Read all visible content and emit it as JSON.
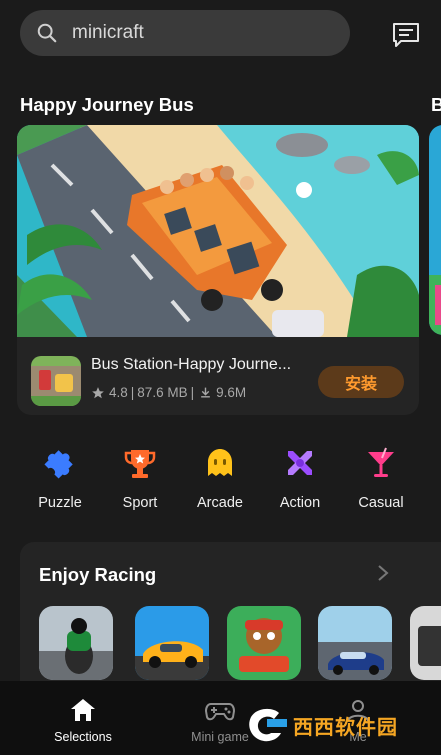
{
  "search": {
    "query": "minicraft"
  },
  "header": {
    "message_icon": "message-icon"
  },
  "featured": {
    "section_title": "Happy Journey Bus",
    "next_section_title": "B",
    "app": {
      "name": "Bus Station-Happy Journe...",
      "rating": "4.8",
      "size": "87.6 MB",
      "downloads": "9.6M",
      "install_label": "安装"
    }
  },
  "categories": [
    {
      "label": "Puzzle",
      "icon": "puzzle-icon",
      "color": "#3b7cff"
    },
    {
      "label": "Sport",
      "icon": "trophy-icon",
      "color": "#ff6a2b"
    },
    {
      "label": "Arcade",
      "icon": "arcade-ghost-icon",
      "color": "#ffc21a"
    },
    {
      "label": "Action",
      "icon": "crossed-swords-icon",
      "color": "#9b4dff"
    },
    {
      "label": "Casual",
      "icon": "cocktail-icon",
      "color": "#ff3d8b"
    }
  ],
  "racing": {
    "title": "Enjoy Racing"
  },
  "bottom_nav": [
    {
      "label": "Selections",
      "icon": "home-icon",
      "active": true
    },
    {
      "label": "Mini game",
      "icon": "gamepad-icon",
      "active": false
    },
    {
      "label": "Me",
      "icon": "profile-icon",
      "active": false
    }
  ],
  "watermark": {
    "text": "西西软件园"
  },
  "colors": {
    "accent": "#ff9a2e",
    "background": "#1b1b1b",
    "card": "#242424"
  }
}
